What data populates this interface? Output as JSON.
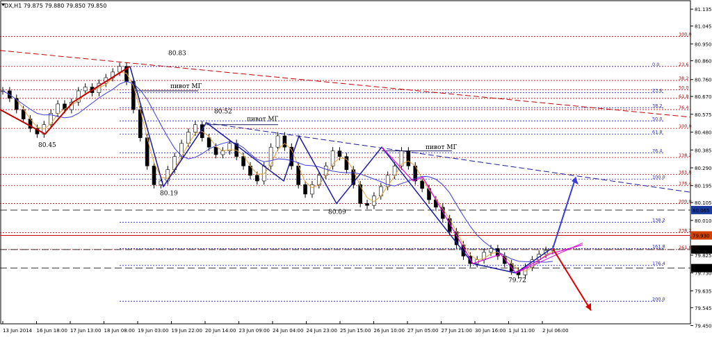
{
  "header": {
    "symbol": "DX,H1",
    "ohlc": "79.875 79.880 79.850 79.850"
  },
  "colors": {
    "candle": "#00a000",
    "ma_fast": "#e8a33c",
    "ma_slow": "#3a3ae0",
    "fib_red": "#c00000",
    "fib_blue": "#2222cc",
    "zigzag_red": "#c00000",
    "zigzag_blue": "#1a1aa0",
    "zigzag_pink": "#e000e0",
    "arrow_blue": "#3a3ae0",
    "arrow_red": "#e00000",
    "trend_red": "#c00000",
    "trend_blue": "#1a1aa0"
  },
  "chart_data": {
    "type": "candlestick",
    "ylim": [
      79.474,
      81.154
    ],
    "y_ticks": [
      "81.135",
      "81.045",
      "80.950",
      "80.860",
      "80.760",
      "80.670",
      "80.575",
      "80.480",
      "80.385",
      "80.290",
      "80.195",
      "80.105",
      "80.010",
      "79.920",
      "79.825",
      "79.730",
      "79.635",
      "79.545",
      "79.450"
    ],
    "x_ticks": [
      "13 Jun 2014",
      "16 Jun 18:00",
      "17 Jun 13:00",
      "18 Jun 08:00",
      "19 Jun 03:00",
      "19 Jun 22:00",
      "20 Jun 14:00",
      "23 Jun 09:00",
      "24 Jun 04:00",
      "24 Jun 23:00",
      "25 Jun 15:00",
      "26 Jun 10:00",
      "27 Jun 05:00",
      "27 Jun 21:00",
      "30 Jun 16:00",
      "1 Jul 11:00",
      "2 Jul 06:00"
    ],
    "price_markers": [
      {
        "label": "80.065",
        "y": 80.065,
        "bg": "#1a3aa0"
      },
      {
        "label": "79.930",
        "y": 79.93,
        "bg": "#d04000"
      },
      {
        "label": "79.855",
        "y": 79.855,
        "bg": "#000000"
      },
      {
        "label": "79.756",
        "y": 79.756,
        "bg": "#000000"
      }
    ],
    "annotations": [
      {
        "text": "80.83",
        "x": "18 Jun 08:00",
        "y": 80.83
      },
      {
        "text": "80.45",
        "x": "16 Jun 18:00",
        "y": 80.45
      },
      {
        "text": "80.52",
        "x": "19 Jun 22:00",
        "y": 80.52
      },
      {
        "text": "80.19",
        "x": "19 Jun 03:00",
        "y": 80.19
      },
      {
        "text": "80.09",
        "x": "25 Jun 15:00",
        "y": 80.09
      },
      {
        "text": "79.72",
        "x": "1 Jul 11:00",
        "y": 79.72
      },
      {
        "text": "пивот МГ",
        "x": "18 Jun 08:00",
        "y": 80.7
      },
      {
        "text": "пивот МГ",
        "x": "19 Jun 22:00",
        "y": 80.52
      },
      {
        "text": "пивот МГ",
        "x": "26 Jun 10:00",
        "y": 80.38
      }
    ],
    "fib_red_labels": [
      "100.0",
      "23.6",
      "38.2",
      "50.0",
      "61.8",
      "76.4",
      "100.0",
      "138.2",
      "161.8",
      "176.4",
      "200.0",
      "238.2",
      "261.8"
    ],
    "fib_blue_labels": [
      "0.0",
      "23.6",
      "38.2",
      "50.0",
      "61.8",
      "76.4",
      "100.0",
      "138.2",
      "161.8",
      "176.4",
      "200.0"
    ],
    "close_series": [
      80.7,
      80.66,
      80.6,
      80.55,
      80.5,
      80.47,
      80.52,
      80.58,
      80.63,
      80.6,
      80.64,
      80.7,
      80.72,
      80.69,
      80.74,
      80.77,
      80.8,
      80.83,
      80.75,
      80.6,
      80.45,
      80.3,
      80.2,
      80.22,
      80.28,
      80.35,
      80.42,
      80.48,
      80.52,
      80.45,
      80.4,
      80.36,
      80.38,
      80.42,
      80.35,
      80.3,
      80.25,
      80.22,
      80.3,
      80.4,
      80.46,
      80.4,
      80.3,
      80.2,
      80.15,
      80.2,
      80.25,
      80.3,
      80.38,
      80.35,
      80.28,
      80.2,
      80.1,
      80.09,
      80.14,
      80.19,
      80.25,
      80.3,
      80.38,
      80.3,
      80.22,
      80.18,
      80.12,
      80.08,
      80.02,
      79.95,
      79.88,
      79.82,
      79.78,
      79.8,
      79.84,
      79.86,
      79.82,
      79.78,
      79.74,
      79.72,
      79.76,
      79.8,
      79.83,
      79.85,
      79.855
    ]
  }
}
